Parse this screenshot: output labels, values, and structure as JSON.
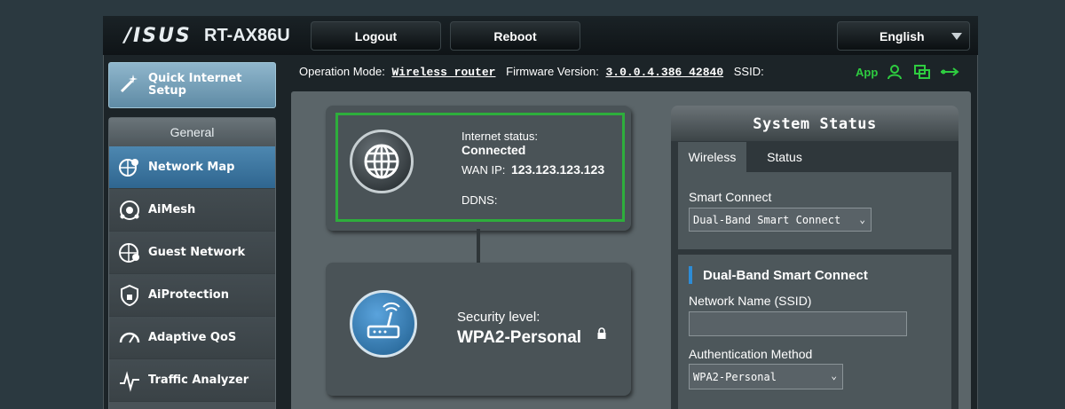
{
  "header": {
    "brand": "/ISUS",
    "model": "RT-AX86U",
    "logout_label": "Logout",
    "reboot_label": "Reboot",
    "language": "English"
  },
  "infobar": {
    "op_mode_label": "Operation Mode:",
    "op_mode_value": "Wireless router",
    "firmware_label": "Firmware Version:",
    "firmware_value": "3.0.0.4.386_42840",
    "ssid_label": "SSID:",
    "app_label": "App"
  },
  "sidebar": {
    "qis_label_1": "Quick Internet",
    "qis_label_2": "Setup",
    "section": "General",
    "items": [
      {
        "label": "Network Map"
      },
      {
        "label": "AiMesh"
      },
      {
        "label": "Guest Network"
      },
      {
        "label": "AiProtection"
      },
      {
        "label": "Adaptive QoS"
      },
      {
        "label": "Traffic Analyzer"
      }
    ]
  },
  "internet": {
    "status_label": "Internet status:",
    "status_value": "Connected",
    "wan_label": "WAN IP:",
    "wan_value": "123.123.123.123",
    "ddns_label": "DDNS:"
  },
  "router": {
    "security_label": "Security level:",
    "security_value": "WPA2-Personal"
  },
  "system_status": {
    "title": "System Status",
    "tabs": [
      "Wireless",
      "Status"
    ],
    "smart_connect_label": "Smart Connect",
    "smart_connect_value": "Dual-Band Smart Connect",
    "band_title": "Dual-Band Smart Connect",
    "ssid_label": "Network Name (SSID)",
    "ssid_value": "",
    "auth_label": "Authentication Method",
    "auth_value": "WPA2-Personal"
  },
  "colors": {
    "accent_blue": "#2f6690",
    "connected_border": "#2eae3c",
    "app_green": "#2ecc40"
  }
}
